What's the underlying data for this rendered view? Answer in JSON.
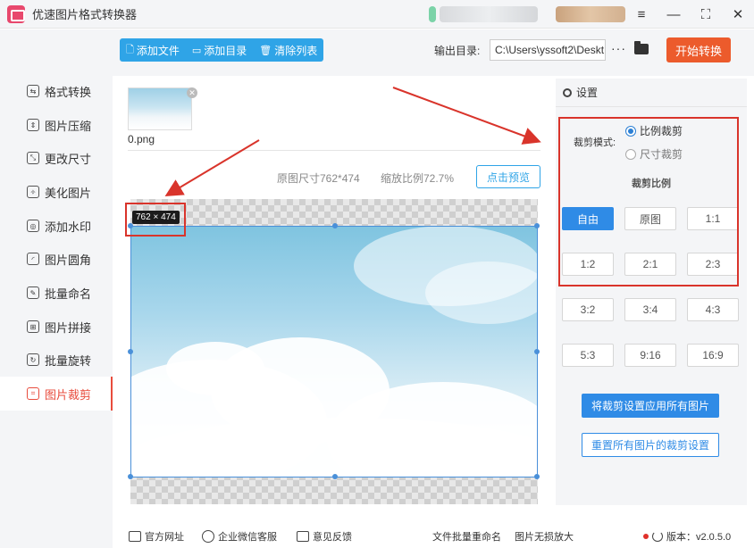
{
  "app": {
    "title": "优速图片格式转换器"
  },
  "window": {
    "menu_glyph": "≡",
    "minimize_glyph": "—",
    "maximize_glyph": "⛶",
    "close_glyph": "✕"
  },
  "sidebar": {
    "items": [
      {
        "label": "格式转换",
        "icon": "convert-icon",
        "glyph": "⇆"
      },
      {
        "label": "图片压缩",
        "icon": "compress-icon",
        "glyph": "⇕"
      },
      {
        "label": "更改尺寸",
        "icon": "resize-icon",
        "glyph": "⤡"
      },
      {
        "label": "美化图片",
        "icon": "beautify-icon",
        "glyph": "✧"
      },
      {
        "label": "添加水印",
        "icon": "watermark-icon",
        "glyph": "◎"
      },
      {
        "label": "图片圆角",
        "icon": "round-corner-icon",
        "glyph": "◜"
      },
      {
        "label": "批量命名",
        "icon": "rename-icon",
        "glyph": "✎"
      },
      {
        "label": "图片拼接",
        "icon": "join-icon",
        "glyph": "⊞"
      },
      {
        "label": "批量旋转",
        "icon": "rotate-icon",
        "glyph": "↻"
      },
      {
        "label": "图片裁剪",
        "icon": "crop-icon",
        "glyph": "⌗"
      }
    ],
    "active_index": 9
  },
  "toolbar": {
    "add_file": "添加文件",
    "add_folder": "添加目录",
    "clear_list": "清除列表",
    "output_label": "输出目录:",
    "output_path": "C:\\Users\\yssoft2\\Deskt",
    "more": "···",
    "start": "开始转换"
  },
  "main": {
    "file_name": "0.png",
    "original_size": "原图尺寸762*474",
    "zoom_ratio": "缩放比例72.7%",
    "preview_button": "点击预览",
    "crop_size_tag": "762 × 474"
  },
  "settings": {
    "header": "设置",
    "crop_mode_label": "裁剪模式:",
    "mode_ratio": "比例裁剪",
    "mode_size": "尺寸裁剪",
    "ratio_title": "裁剪比例",
    "ratios": [
      "自由",
      "原图",
      "1:1",
      "1:2",
      "2:1",
      "2:3",
      "3:2",
      "3:4",
      "4:3",
      "5:3",
      "9:16",
      "16:9"
    ],
    "active_ratio": "自由",
    "apply_all": "将裁剪设置应用所有图片",
    "reset_all": "重置所有图片的裁剪设置"
  },
  "footer": {
    "website": "官方网址",
    "wechat": "企业微信客服",
    "feedback": "意见反馈",
    "batch_rename": "文件批量重命名",
    "lossless_zoom": "图片无损放大",
    "version": "版本：v2.0.5.0"
  },
  "colors": {
    "accent": "#2f8be6",
    "start": "#ec5b2c",
    "annotation_red": "#d9342b",
    "active_side": "#e84c3d"
  }
}
